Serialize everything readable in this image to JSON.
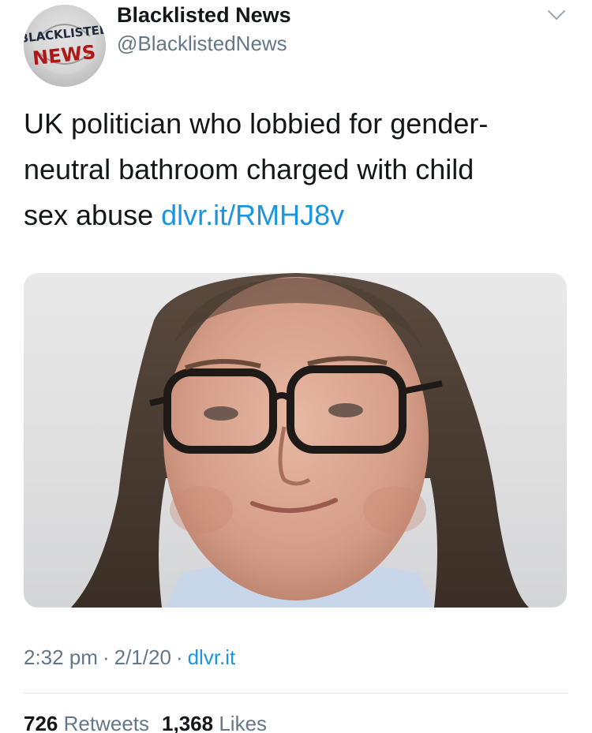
{
  "account": {
    "display_name": "Blacklisted News",
    "handle": "@BlacklistedNews",
    "avatar_text_top": "BLACKLISTED",
    "avatar_text_bottom": "NEWS"
  },
  "tweet": {
    "line1": "UK politician who lobbied for gender-",
    "line2": "neutral bathroom charged with child",
    "line3_text": "sex abuse ",
    "link_text": "dlvr.it/RMHJ8v"
  },
  "meta": {
    "time": "2:32 pm",
    "date": "2/1/20",
    "source": "dlvr.it",
    "separator": "·"
  },
  "stats": {
    "retweets_count": "726",
    "retweets_label": "Retweets",
    "likes_count": "1,368",
    "likes_label": "Likes"
  },
  "icons": {
    "caret": "chevron-down-icon"
  },
  "colors": {
    "link": "#1b95e0",
    "secondary_text": "#657786",
    "primary_text": "#14171a"
  }
}
